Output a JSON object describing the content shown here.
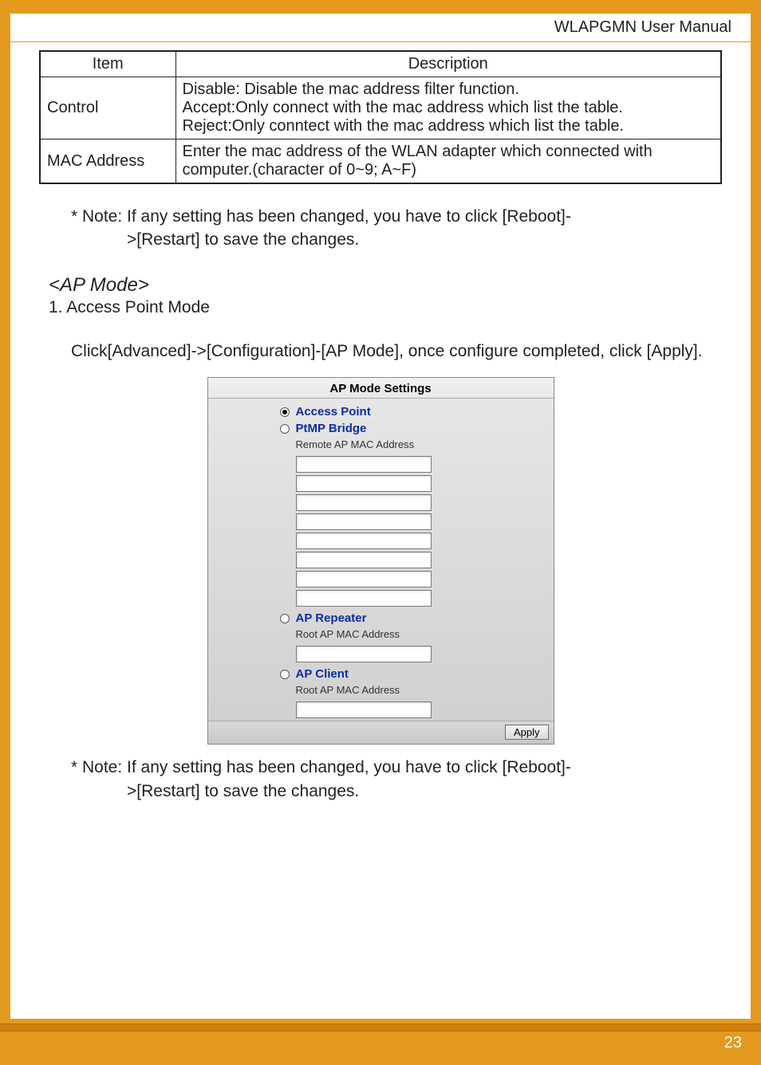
{
  "header": {
    "doc_title": "WLAPGMN User Manual"
  },
  "table": {
    "headers": [
      "Item",
      "Description"
    ],
    "rows": [
      {
        "item": "Control",
        "desc": "Disable: Disable the mac address filter function.\nAccept:Only connect with the mac address which list  the table.\nReject:Only conntect with the mac address which list  the table."
      },
      {
        "item": "MAC Address",
        "desc": "Enter the mac address of the WLAN adapter which connected with computer.(character of 0~9; A~F)"
      }
    ]
  },
  "note1_line1": "* Note: If any setting has been changed, you have to click [Reboot]-",
  "note1_line2": ">[Restart] to save the changes.",
  "section_title": "<AP Mode>",
  "subhead": "1. Access Point Mode",
  "paragraph": "Click[Advanced]->[Configuration]-[AP Mode], once configure completed, click [Apply].",
  "panel": {
    "title": "AP Mode Settings",
    "options": [
      {
        "id": "access-point",
        "label": "Access Point",
        "checked": true
      },
      {
        "id": "ptmp-bridge",
        "label": "PtMP Bridge",
        "checked": false,
        "sublabel": "Remote AP MAC Address",
        "inputs": 8
      },
      {
        "id": "ap-repeater",
        "label": "AP Repeater",
        "checked": false,
        "sublabel": "Root AP MAC Address",
        "inputs": 1
      },
      {
        "id": "ap-client",
        "label": "AP Client",
        "checked": false,
        "sublabel": "Root AP MAC Address",
        "inputs": 1
      }
    ],
    "apply_label": "Apply"
  },
  "note2_line1": "* Note: If any setting has been changed, you have to click [Reboot]-",
  "note2_line2": ">[Restart] to save the changes.",
  "page_number": "23"
}
